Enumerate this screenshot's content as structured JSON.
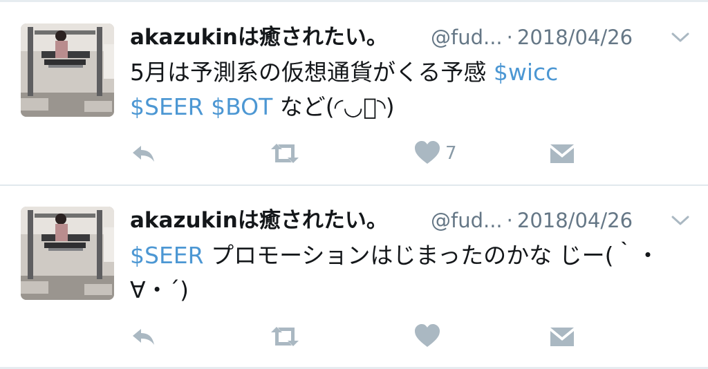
{
  "tweets": [
    {
      "author_name": "akazukinは癒されたい。",
      "handle": "@fud...",
      "separator": "·",
      "date": "2018/04/26",
      "text_parts": [
        {
          "text": "5月は予測系の仮想通貨がくる予感 ",
          "type": "plain"
        },
        {
          "text": "$wicc",
          "type": "cashtag"
        },
        {
          "text": " ",
          "type": "plain"
        },
        {
          "text": "$SEER",
          "type": "cashtag"
        },
        {
          "text": " ",
          "type": "plain"
        },
        {
          "text": "$BOT",
          "type": "cashtag"
        },
        {
          "text": " など(◜◡͐◝)",
          "type": "plain"
        }
      ],
      "like_count": "7"
    },
    {
      "author_name": "akazukinは癒されたい。",
      "handle": "@fud...",
      "separator": "·",
      "date": "2018/04/26",
      "text_parts": [
        {
          "text": "$SEER",
          "type": "cashtag"
        },
        {
          "text": " プロモーションはじまったのかな じー(｀・∀・´)",
          "type": "plain"
        }
      ],
      "like_count": ""
    }
  ],
  "icons": {
    "reply": "reply-arrow-icon",
    "retweet": "retweet-icon",
    "like": "heart-icon",
    "dm": "envelope-icon",
    "menu": "chevron-down-icon"
  },
  "colors": {
    "cashtag": "#4c97d3",
    "icon_gray": "#aab8c2",
    "meta_gray": "#657786",
    "divider": "#e1e8ed"
  }
}
